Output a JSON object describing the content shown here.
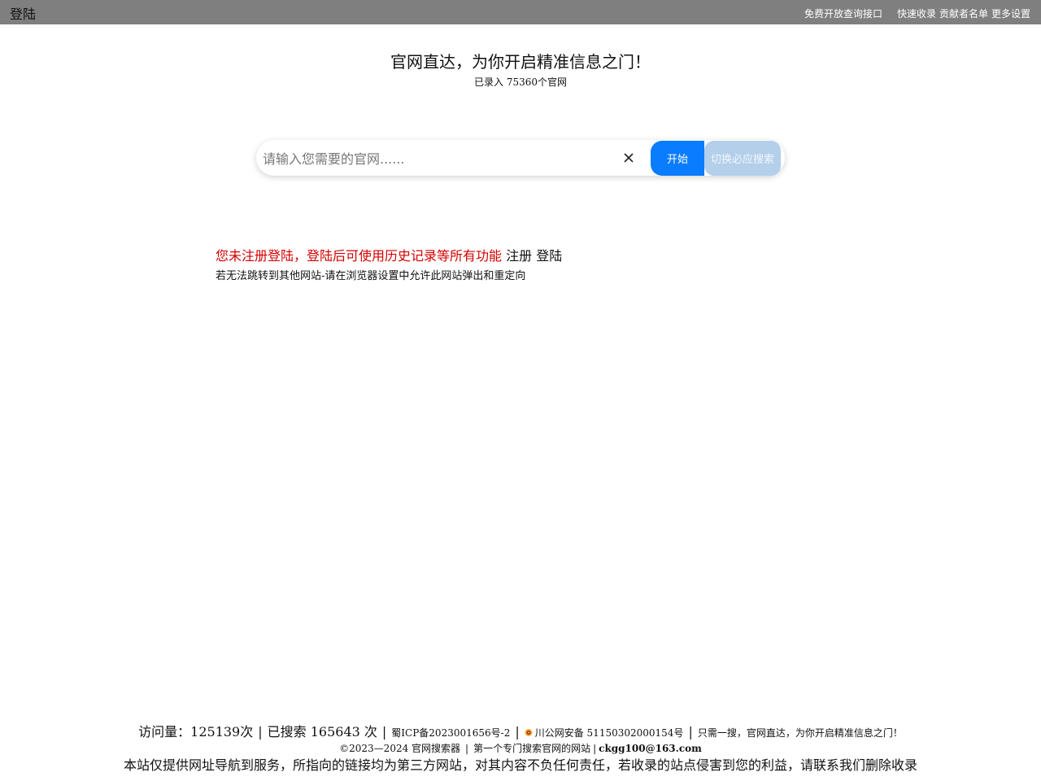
{
  "topbar": {
    "login_label": "登陆",
    "api_link": "免费开放查询接口",
    "quick_include": "快速收录",
    "contributors": "贡献者名单",
    "more_settings": "更多设置"
  },
  "hero": {
    "title": "官网直达，为你开启精准信息之门！",
    "subtitle": "已录入 75360个官网"
  },
  "search": {
    "placeholder": "请输入您需要的官网......",
    "value": "",
    "clear_icon": "close-icon",
    "start_label": "开始",
    "switch_label": "切换必应搜索"
  },
  "notice": {
    "warning": "您未注册登陆，登陆后可使用历史记录等所有功能",
    "register": "注册",
    "login": "登陆",
    "tip": "若无法跳转到其他网站-请在浏览器设置中允许此网站弹出和重定向"
  },
  "footer": {
    "visits": "访问量：125139次",
    "searches": "已搜索 165643 次",
    "icp": "蜀ICP备2023001656号-2",
    "police": "川公网安备 51150302000154号",
    "slogan": "只需一搜，官网直达，为你开启精准信息之门！",
    "copyright": "©2023—2024 官网搜索器",
    "tagline": "第一个专门搜索官网的网站",
    "email": "ckgg100@163.com",
    "disclaimer": "本站仅提供网址导航到服务，所指向的链接均为第三方网站，对其内容不负任何责任，若收录的站点侵害到您的利益，请联系我们删除收录",
    "separator": "|"
  },
  "colors": {
    "topbar_bg": "#7f7f7f",
    "primary_button": "#0a7cff",
    "secondary_button": "#b3cfea",
    "warning_text": "#d40000"
  }
}
